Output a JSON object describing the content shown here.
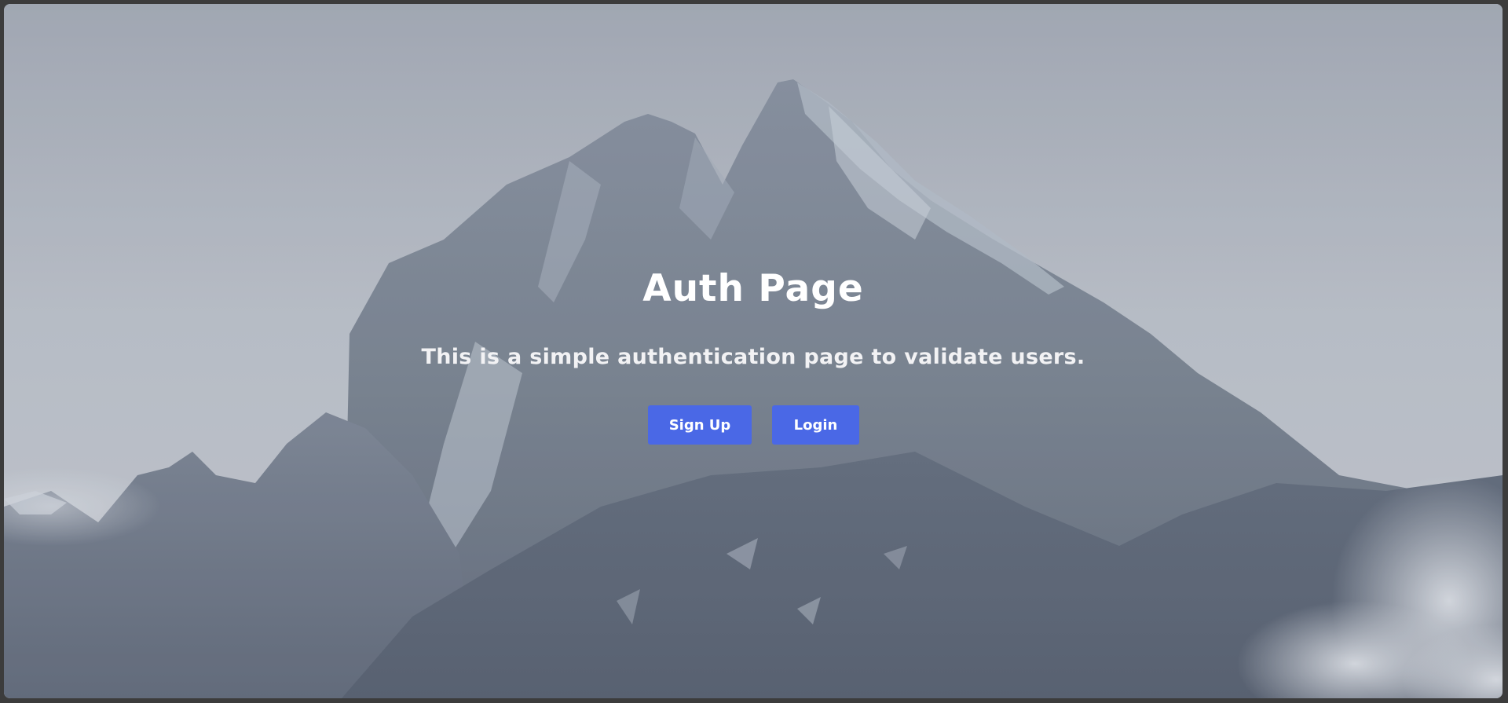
{
  "hero": {
    "title": "Auth Page",
    "subtitle": "This is a simple authentication page to validate users.",
    "background_image": "snow-capped mountain peaks under an overcast sky"
  },
  "actions": {
    "signup_label": "Sign Up",
    "login_label": "Login"
  },
  "colors": {
    "button": "#4a68e6",
    "button_text": "#ffffff",
    "title_text": "#ffffff",
    "sky": "#c9ced6",
    "mountain_dark": "#5d6778",
    "frame_border": "#3c3c3c"
  }
}
